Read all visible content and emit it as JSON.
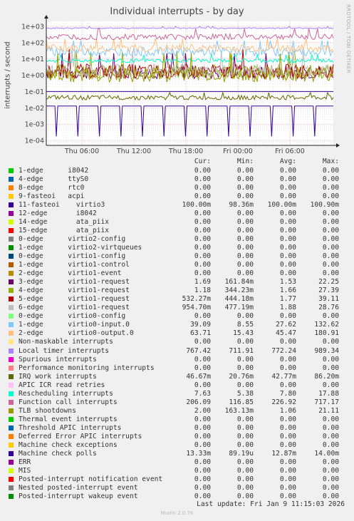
{
  "title": "Individual interrupts - by day",
  "side_label": "RRDTOOL / TOBI OETIKER",
  "footer": {
    "last_update": "Last update: Fri Jan  9 11:15:03 2026",
    "version": "Munin 2.0.76"
  },
  "legend_headers": {
    "cur": "Cur:",
    "min": "Min:",
    "avg": "Avg:",
    "max": "Max:"
  },
  "chart_data": {
    "type": "line",
    "title": "Individual interrupts - by day",
    "ylabel": "interrupts / second",
    "yscale": "log",
    "ylim": [
      5e-05,
      2000
    ],
    "y_ticks": [
      "1e-04",
      "1e-03",
      "1e-02",
      "1e-01",
      "1e+00",
      "1e+01",
      "1e+02",
      "1e+03"
    ],
    "x_ticks": [
      "Thu 06:00",
      "Thu 12:00",
      "Thu 18:00",
      "Fri 00:00",
      "Fri 06:00"
    ],
    "grid": true,
    "series": [
      {
        "name": "1-edge      i8042",
        "color": "#00cc00",
        "cur": "0.00",
        "min": "0.00",
        "avg": "0.00",
        "max": "0.00"
      },
      {
        "name": "4-edge      ttyS0",
        "color": "#0066b3",
        "cur": "0.00",
        "min": "0.00",
        "avg": "0.00",
        "max": "0.00"
      },
      {
        "name": "8-edge      rtc0",
        "color": "#ff8000",
        "cur": "0.00",
        "min": "0.00",
        "avg": "0.00",
        "max": "0.00"
      },
      {
        "name": "9-fasteoi   acpi",
        "color": "#ffcc00",
        "cur": "0.00",
        "min": "0.00",
        "avg": "0.00",
        "max": "0.00"
      },
      {
        "name": "11-fasteoi    virtio3",
        "color": "#330099",
        "cur": "100.00m",
        "min": "98.36m",
        "avg": "100.00m",
        "max": "100.90m"
      },
      {
        "name": "12-edge       i8042",
        "color": "#990099",
        "cur": "0.00",
        "min": "0.00",
        "avg": "0.00",
        "max": "0.00"
      },
      {
        "name": "14-edge       ata_piix",
        "color": "#ccff00",
        "cur": "0.00",
        "min": "0.00",
        "avg": "0.00",
        "max": "0.00"
      },
      {
        "name": "15-edge       ata_piix",
        "color": "#ff0000",
        "cur": "0.00",
        "min": "0.00",
        "avg": "0.00",
        "max": "0.00"
      },
      {
        "name": "0-edge      virtio2-config",
        "color": "#808080",
        "cur": "0.00",
        "min": "0.00",
        "avg": "0.00",
        "max": "0.00"
      },
      {
        "name": "1-edge      virtio2-virtqueues",
        "color": "#008f00",
        "cur": "0.00",
        "min": "0.00",
        "avg": "0.00",
        "max": "0.00"
      },
      {
        "name": "0-edge      virtio1-config",
        "color": "#00487d",
        "cur": "0.00",
        "min": "0.00",
        "avg": "0.00",
        "max": "0.00"
      },
      {
        "name": "1-edge      virtio1-control",
        "color": "#b35a00",
        "cur": "0.00",
        "min": "0.00",
        "avg": "0.00",
        "max": "0.00"
      },
      {
        "name": "2-edge      virtio1-event",
        "color": "#b38f00",
        "cur": "0.00",
        "min": "0.00",
        "avg": "0.00",
        "max": "0.00"
      },
      {
        "name": "3-edge      virtio1-request",
        "color": "#6b006b",
        "cur": "1.69",
        "min": "161.84m",
        "avg": "1.53",
        "max": "22.25"
      },
      {
        "name": "4-edge      virtio1-request",
        "color": "#8fb300",
        "cur": "1.18",
        "min": "344.23m",
        "avg": "1.66",
        "max": "27.39"
      },
      {
        "name": "5-edge      virtio1-request",
        "color": "#b30000",
        "cur": "532.27m",
        "min": "444.18m",
        "avg": "1.77",
        "max": "39.11"
      },
      {
        "name": "6-edge      virtio1-request",
        "color": "#bebebe",
        "cur": "954.70m",
        "min": "477.19m",
        "avg": "1.88",
        "max": "28.76"
      },
      {
        "name": "0-edge      virtio0-config",
        "color": "#80ff80",
        "cur": "0.00",
        "min": "0.00",
        "avg": "0.00",
        "max": "0.00"
      },
      {
        "name": "1-edge      virtio0-input.0",
        "color": "#80c9ff",
        "cur": "39.09",
        "min": "8.55",
        "avg": "27.62",
        "max": "132.62"
      },
      {
        "name": "2-edge      virtio0-output.0",
        "color": "#ffc080",
        "cur": "63.71",
        "min": "15.43",
        "avg": "45.47",
        "max": "180.91"
      },
      {
        "name": "Non-maskable interrupts",
        "color": "#ffe680",
        "cur": "0.00",
        "min": "0.00",
        "avg": "0.00",
        "max": "0.00"
      },
      {
        "name": "Local timer interrupts",
        "color": "#aa80ff",
        "cur": "767.42",
        "min": "711.91",
        "avg": "772.24",
        "max": "989.34"
      },
      {
        "name": "Spurious interrupts",
        "color": "#ee00cc",
        "cur": "0.00",
        "min": "0.00",
        "avg": "0.00",
        "max": "0.00"
      },
      {
        "name": "Performance monitoring interrupts",
        "color": "#ff8080",
        "cur": "0.00",
        "min": "0.00",
        "avg": "0.00",
        "max": "0.00"
      },
      {
        "name": "IRQ work interrupts",
        "color": "#666600",
        "cur": "46.67m",
        "min": "20.76m",
        "avg": "42.77m",
        "max": "86.20m"
      },
      {
        "name": "APIC ICR read retries",
        "color": "#ffbfff",
        "cur": "0.00",
        "min": "0.00",
        "avg": "0.00",
        "max": "0.00"
      },
      {
        "name": "Rescheduling interrupts",
        "color": "#00ffcc",
        "cur": "7.63",
        "min": "5.38",
        "avg": "7.80",
        "max": "17.88"
      },
      {
        "name": "Function call interrupts",
        "color": "#cc6699",
        "cur": "206.09",
        "min": "116.85",
        "avg": "226.92",
        "max": "717.17"
      },
      {
        "name": "TLB shootdowns",
        "color": "#999900",
        "cur": "2.00",
        "min": "163.13m",
        "avg": "1.06",
        "max": "21.11"
      },
      {
        "name": "Thermal event interrupts",
        "color": "#00cc00",
        "cur": "0.00",
        "min": "0.00",
        "avg": "0.00",
        "max": "0.00"
      },
      {
        "name": "Threshold APIC interrupts",
        "color": "#0066b3",
        "cur": "0.00",
        "min": "0.00",
        "avg": "0.00",
        "max": "0.00"
      },
      {
        "name": "Deferred Error APIC interrupts",
        "color": "#ff8000",
        "cur": "0.00",
        "min": "0.00",
        "avg": "0.00",
        "max": "0.00"
      },
      {
        "name": "Machine check exceptions",
        "color": "#ffcc00",
        "cur": "0.00",
        "min": "0.00",
        "avg": "0.00",
        "max": "0.00"
      },
      {
        "name": "Machine check polls",
        "color": "#330099",
        "cur": "13.33m",
        "min": "89.19u",
        "avg": "12.87m",
        "max": "14.00m"
      },
      {
        "name": "ERR",
        "color": "#990099",
        "cur": "0.00",
        "min": "0.00",
        "avg": "0.00",
        "max": "0.00"
      },
      {
        "name": "MIS",
        "color": "#ccff00",
        "cur": "0.00",
        "min": "0.00",
        "avg": "0.00",
        "max": "0.00"
      },
      {
        "name": "Posted-interrupt notification event",
        "color": "#ff0000",
        "cur": "0.00",
        "min": "0.00",
        "avg": "0.00",
        "max": "0.00"
      },
      {
        "name": "Nested posted-interrupt event",
        "color": "#808080",
        "cur": "0.00",
        "min": "0.00",
        "avg": "0.00",
        "max": "0.00"
      },
      {
        "name": "Posted-interrupt wakeup event",
        "color": "#008f00",
        "cur": "0.00",
        "min": "0.00",
        "avg": "0.00",
        "max": "0.00"
      }
    ]
  }
}
